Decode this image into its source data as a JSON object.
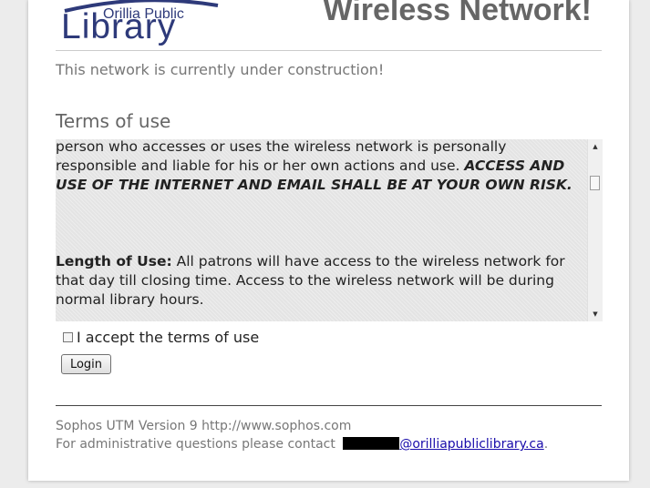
{
  "header": {
    "logo_small": "Orillia Public",
    "logo_big": "Library",
    "title": "Wireless Network!"
  },
  "status_message": "This network is currently under construction!",
  "terms": {
    "heading": "Terms of use",
    "para1_text": "person who accesses or uses the wireless network is personally responsible and liable for his or her own actions and use. ",
    "para1_emphasis": "ACCESS AND USE OF THE INTERNET AND EMAIL SHALL BE AT YOUR OWN RISK.",
    "para2_label": "Length of Use:",
    "para2_text": " All patrons will have access to the wireless network for that day till closing time. Access to the wireless network will be during normal library hours.",
    "scroll_up_glyph": "▲",
    "scroll_down_glyph": "▼"
  },
  "form": {
    "accept_label": "I accept the terms of use",
    "accept_checked": false,
    "login_label": "Login"
  },
  "footer": {
    "version": "Sophos UTM Version 9 http://www.sophos.com",
    "contact_prefix": "For administrative questions please contact ",
    "email_visible": "@orilliapubliclibrary.ca",
    "contact_suffix": "."
  },
  "colors": {
    "logo_blue": "#2e3a7a",
    "title_gray": "#666666",
    "link_blue": "#1a0dab"
  }
}
